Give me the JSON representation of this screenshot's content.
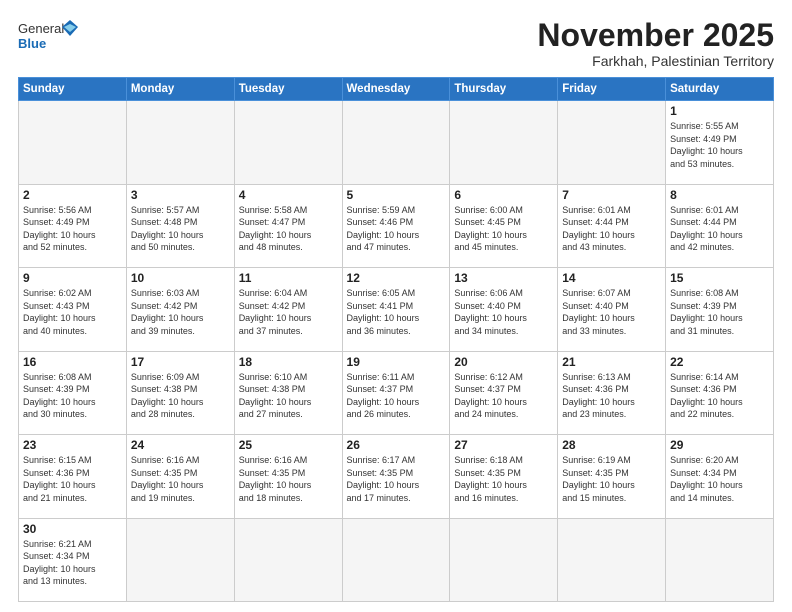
{
  "header": {
    "logo_general": "General",
    "logo_blue": "Blue",
    "month_title": "November 2025",
    "location": "Farkhah, Palestinian Territory"
  },
  "days_of_week": [
    "Sunday",
    "Monday",
    "Tuesday",
    "Wednesday",
    "Thursday",
    "Friday",
    "Saturday"
  ],
  "weeks": [
    [
      {
        "day": "",
        "info": "",
        "empty": true
      },
      {
        "day": "",
        "info": "",
        "empty": true
      },
      {
        "day": "",
        "info": "",
        "empty": true
      },
      {
        "day": "",
        "info": "",
        "empty": true
      },
      {
        "day": "",
        "info": "",
        "empty": true
      },
      {
        "day": "",
        "info": "",
        "empty": true
      },
      {
        "day": "1",
        "info": "Sunrise: 5:55 AM\nSunset: 4:49 PM\nDaylight: 10 hours\nand 53 minutes."
      }
    ],
    [
      {
        "day": "2",
        "info": "Sunrise: 5:56 AM\nSunset: 4:49 PM\nDaylight: 10 hours\nand 52 minutes."
      },
      {
        "day": "3",
        "info": "Sunrise: 5:57 AM\nSunset: 4:48 PM\nDaylight: 10 hours\nand 50 minutes."
      },
      {
        "day": "4",
        "info": "Sunrise: 5:58 AM\nSunset: 4:47 PM\nDaylight: 10 hours\nand 48 minutes."
      },
      {
        "day": "5",
        "info": "Sunrise: 5:59 AM\nSunset: 4:46 PM\nDaylight: 10 hours\nand 47 minutes."
      },
      {
        "day": "6",
        "info": "Sunrise: 6:00 AM\nSunset: 4:45 PM\nDaylight: 10 hours\nand 45 minutes."
      },
      {
        "day": "7",
        "info": "Sunrise: 6:01 AM\nSunset: 4:44 PM\nDaylight: 10 hours\nand 43 minutes."
      },
      {
        "day": "8",
        "info": "Sunrise: 6:01 AM\nSunset: 4:44 PM\nDaylight: 10 hours\nand 42 minutes."
      }
    ],
    [
      {
        "day": "9",
        "info": "Sunrise: 6:02 AM\nSunset: 4:43 PM\nDaylight: 10 hours\nand 40 minutes."
      },
      {
        "day": "10",
        "info": "Sunrise: 6:03 AM\nSunset: 4:42 PM\nDaylight: 10 hours\nand 39 minutes."
      },
      {
        "day": "11",
        "info": "Sunrise: 6:04 AM\nSunset: 4:42 PM\nDaylight: 10 hours\nand 37 minutes."
      },
      {
        "day": "12",
        "info": "Sunrise: 6:05 AM\nSunset: 4:41 PM\nDaylight: 10 hours\nand 36 minutes."
      },
      {
        "day": "13",
        "info": "Sunrise: 6:06 AM\nSunset: 4:40 PM\nDaylight: 10 hours\nand 34 minutes."
      },
      {
        "day": "14",
        "info": "Sunrise: 6:07 AM\nSunset: 4:40 PM\nDaylight: 10 hours\nand 33 minutes."
      },
      {
        "day": "15",
        "info": "Sunrise: 6:08 AM\nSunset: 4:39 PM\nDaylight: 10 hours\nand 31 minutes."
      }
    ],
    [
      {
        "day": "16",
        "info": "Sunrise: 6:08 AM\nSunset: 4:39 PM\nDaylight: 10 hours\nand 30 minutes."
      },
      {
        "day": "17",
        "info": "Sunrise: 6:09 AM\nSunset: 4:38 PM\nDaylight: 10 hours\nand 28 minutes."
      },
      {
        "day": "18",
        "info": "Sunrise: 6:10 AM\nSunset: 4:38 PM\nDaylight: 10 hours\nand 27 minutes."
      },
      {
        "day": "19",
        "info": "Sunrise: 6:11 AM\nSunset: 4:37 PM\nDaylight: 10 hours\nand 26 minutes."
      },
      {
        "day": "20",
        "info": "Sunrise: 6:12 AM\nSunset: 4:37 PM\nDaylight: 10 hours\nand 24 minutes."
      },
      {
        "day": "21",
        "info": "Sunrise: 6:13 AM\nSunset: 4:36 PM\nDaylight: 10 hours\nand 23 minutes."
      },
      {
        "day": "22",
        "info": "Sunrise: 6:14 AM\nSunset: 4:36 PM\nDaylight: 10 hours\nand 22 minutes."
      }
    ],
    [
      {
        "day": "23",
        "info": "Sunrise: 6:15 AM\nSunset: 4:36 PM\nDaylight: 10 hours\nand 21 minutes."
      },
      {
        "day": "24",
        "info": "Sunrise: 6:16 AM\nSunset: 4:35 PM\nDaylight: 10 hours\nand 19 minutes."
      },
      {
        "day": "25",
        "info": "Sunrise: 6:16 AM\nSunset: 4:35 PM\nDaylight: 10 hours\nand 18 minutes."
      },
      {
        "day": "26",
        "info": "Sunrise: 6:17 AM\nSunset: 4:35 PM\nDaylight: 10 hours\nand 17 minutes."
      },
      {
        "day": "27",
        "info": "Sunrise: 6:18 AM\nSunset: 4:35 PM\nDaylight: 10 hours\nand 16 minutes."
      },
      {
        "day": "28",
        "info": "Sunrise: 6:19 AM\nSunset: 4:35 PM\nDaylight: 10 hours\nand 15 minutes."
      },
      {
        "day": "29",
        "info": "Sunrise: 6:20 AM\nSunset: 4:34 PM\nDaylight: 10 hours\nand 14 minutes."
      }
    ],
    [
      {
        "day": "30",
        "info": "Sunrise: 6:21 AM\nSunset: 4:34 PM\nDaylight: 10 hours\nand 13 minutes."
      },
      {
        "day": "",
        "info": "",
        "empty": true
      },
      {
        "day": "",
        "info": "",
        "empty": true
      },
      {
        "day": "",
        "info": "",
        "empty": true
      },
      {
        "day": "",
        "info": "",
        "empty": true
      },
      {
        "day": "",
        "info": "",
        "empty": true
      },
      {
        "day": "",
        "info": "",
        "empty": true
      }
    ]
  ]
}
